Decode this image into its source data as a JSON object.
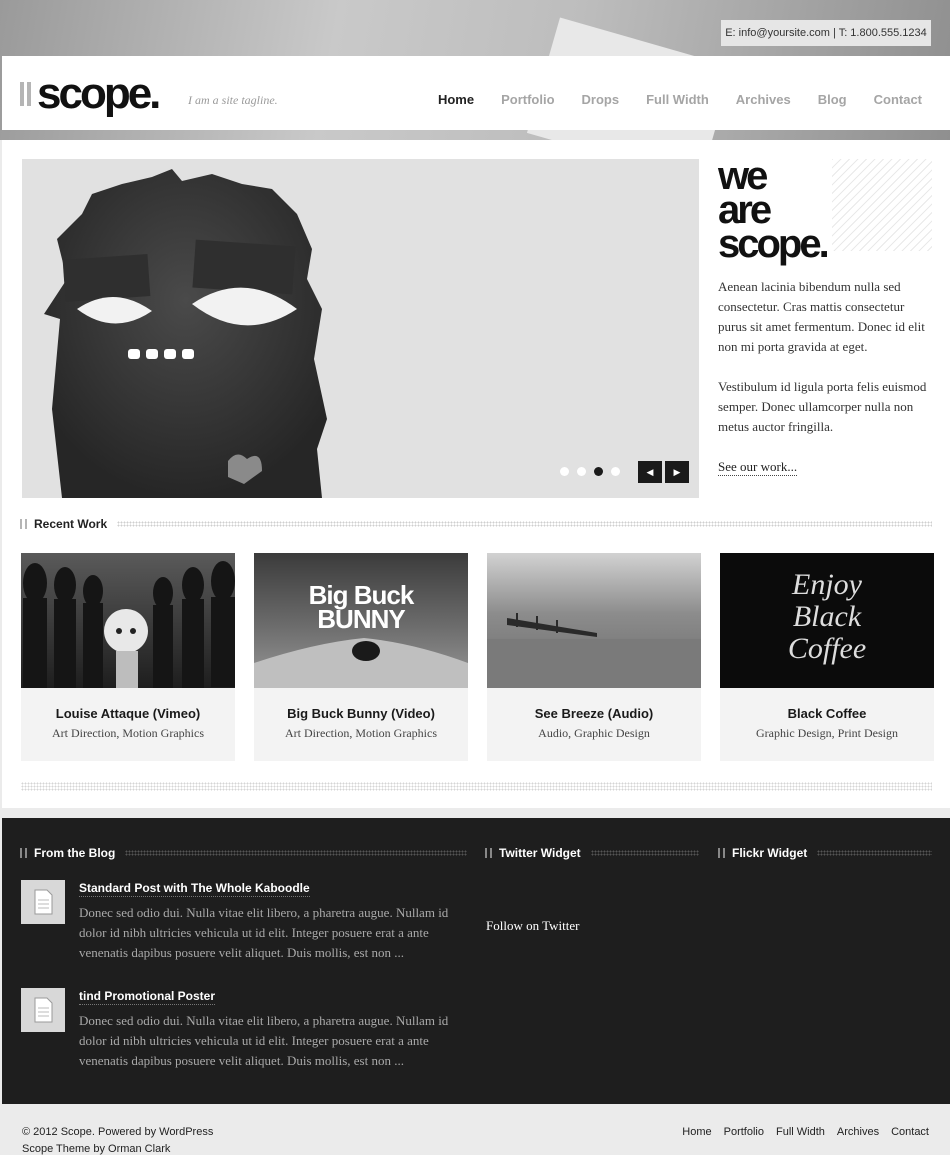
{
  "topbar": {
    "contact": "E: info@yoursite.com | T: 1.800.555.1234"
  },
  "header": {
    "logo": "scope.",
    "tagline": "I am a site tagline.",
    "nav": [
      "Home",
      "Portfolio",
      "Drops",
      "Full Width",
      "Archives",
      "Blog",
      "Contact"
    ],
    "active_nav": "Home"
  },
  "intro": {
    "heading_lines": [
      "we",
      "are",
      "scope."
    ],
    "paragraph1": "Aenean lacinia bibendum nulla sed consectetur. Cras mattis consectetur purus sit amet fermentum. Donec id elit non mi porta gravida at eget.",
    "paragraph2": "Vestibulum id ligula porta felis euismod semper. Donec ullamcorper nulla non metus auctor fringilla.",
    "link": "See our work..."
  },
  "slider": {
    "slide_count": 4,
    "active_slide": 3
  },
  "recent_work": {
    "heading": "Recent Work",
    "items": [
      {
        "title": "Louise Attaque (Vimeo)",
        "categories": "Art Direction, Motion Graphics"
      },
      {
        "title": "Big Buck Bunny (Video)",
        "categories": "Art Direction, Motion Graphics",
        "thumb_text": [
          "Big Buck",
          "BUNNY"
        ]
      },
      {
        "title": "See Breeze (Audio)",
        "categories": "Audio, Graphic Design"
      },
      {
        "title": "Black Coffee",
        "categories": "Graphic Design, Print Design",
        "thumb_text": [
          "Enjoy",
          "Black",
          "Coffee"
        ]
      }
    ]
  },
  "widgets": {
    "blog": {
      "heading": "From the Blog",
      "posts": [
        {
          "title": "Standard Post with The Whole Kaboodle",
          "excerpt": "Donec sed odio dui. Nulla vitae elit libero, a pharetra augue. Nullam id dolor id nibh ultricies vehicula ut id elit. Integer posuere erat a ante venenatis dapibus posuere velit aliquet. Duis mollis, est non ..."
        },
        {
          "title": "tind Promotional Poster",
          "excerpt": "Donec sed odio dui. Nulla vitae elit libero, a pharetra augue. Nullam id dolor id nibh ultricies vehicula ut id elit. Integer posuere erat a ante venenatis dapibus posuere velit aliquet. Duis mollis, est non ..."
        }
      ]
    },
    "twitter": {
      "heading": "Twitter Widget",
      "follow": "Follow on Twitter"
    },
    "flickr": {
      "heading": "Flickr Widget"
    }
  },
  "footer": {
    "copyright": "© 2012 Scope. Powered by WordPress",
    "credit": "Scope Theme by Orman Clark",
    "nav": [
      "Home",
      "Portfolio",
      "Full Width",
      "Archives",
      "Contact"
    ]
  }
}
